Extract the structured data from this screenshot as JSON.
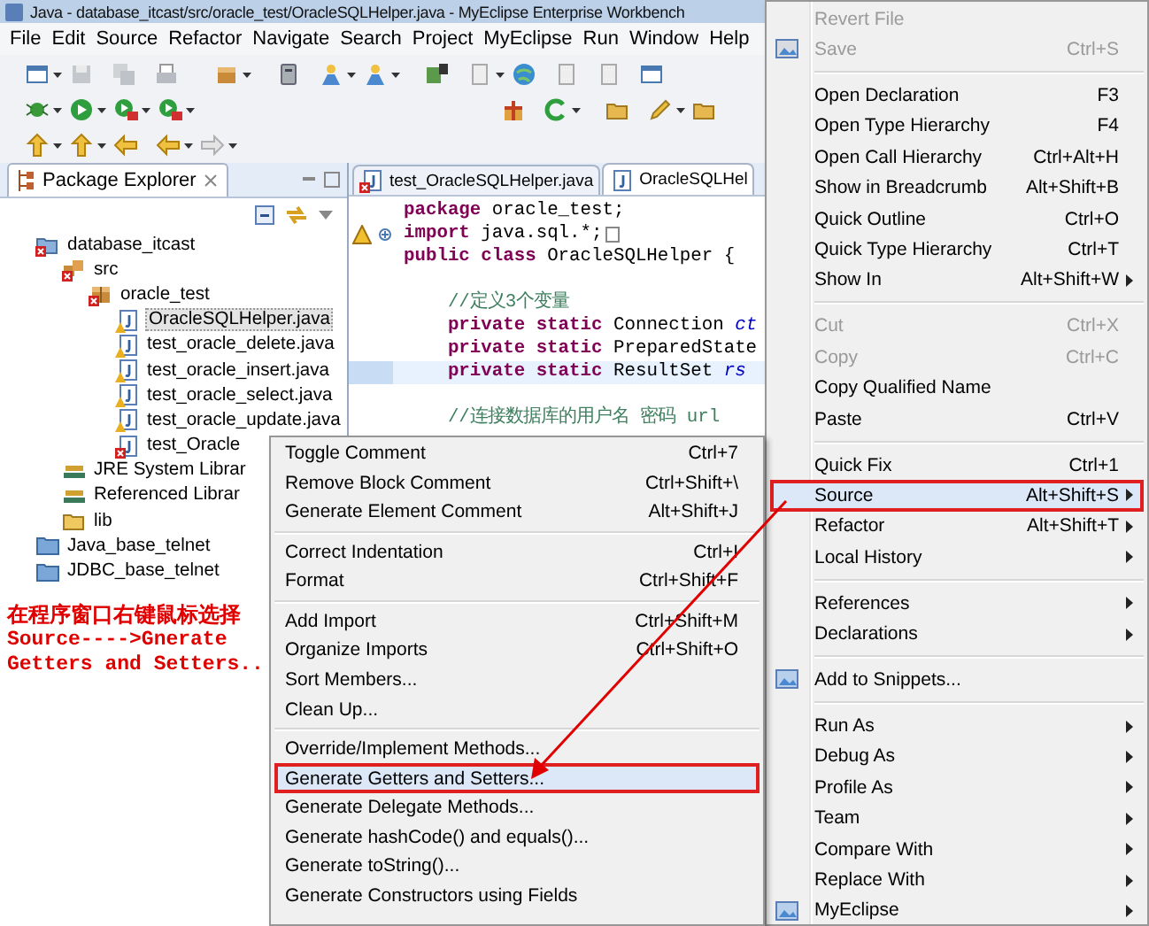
{
  "window": {
    "title": "Java - database_itcast/src/oracle_test/OracleSQLHelper.java - MyEclipse Enterprise Workbench"
  },
  "menu_bar": [
    "File",
    "Edit",
    "Source",
    "Refactor",
    "Navigate",
    "Search",
    "Project",
    "MyEclipse",
    "Run",
    "Window",
    "Help"
  ],
  "package_explorer": {
    "title": "Package Explorer",
    "tree": [
      {
        "label": "database_itcast",
        "kind": "project",
        "error": true,
        "warning": false,
        "selected": false,
        "children": [
          {
            "label": "src",
            "kind": "source-folder",
            "error": true,
            "warning": false,
            "selected": false,
            "children": [
              {
                "label": "oracle_test",
                "kind": "package",
                "error": true,
                "warning": false,
                "selected": false,
                "children": [
                  {
                    "label": "OracleSQLHelper.java",
                    "kind": "java-file",
                    "error": false,
                    "warning": true,
                    "selected": true
                  },
                  {
                    "label": "test_oracle_delete.java",
                    "kind": "java-file",
                    "error": false,
                    "warning": true,
                    "selected": false
                  },
                  {
                    "label": "test_oracle_insert.java",
                    "kind": "java-file",
                    "error": false,
                    "warning": true,
                    "selected": false
                  },
                  {
                    "label": "test_oracle_select.java",
                    "kind": "java-file",
                    "error": false,
                    "warning": true,
                    "selected": false
                  },
                  {
                    "label": "test_oracle_update.java",
                    "kind": "java-file",
                    "error": false,
                    "warning": true,
                    "selected": false
                  },
                  {
                    "label": "test_Oracle",
                    "kind": "java-file",
                    "error": true,
                    "warning": false,
                    "selected": false
                  }
                ]
              }
            ]
          },
          {
            "label": "JRE System Librar",
            "kind": "library",
            "error": false,
            "warning": false,
            "selected": false
          },
          {
            "label": "Referenced Librar",
            "kind": "library",
            "error": false,
            "warning": false,
            "selected": false
          },
          {
            "label": "lib",
            "kind": "folder",
            "error": false,
            "warning": false,
            "selected": false
          }
        ]
      },
      {
        "label": "Java_base_telnet",
        "kind": "closed-project",
        "error": false,
        "warning": false,
        "selected": false
      },
      {
        "label": "JDBC_base_telnet",
        "kind": "closed-project",
        "error": false,
        "warning": false,
        "selected": false
      }
    ]
  },
  "editor": {
    "tabs": [
      {
        "label": "test_OracleSQLHelper.java",
        "selected": false,
        "error": true
      },
      {
        "label": "OracleSQLHel",
        "selected": true,
        "error": false
      }
    ],
    "lines": [
      {
        "current": false,
        "tokens": [
          {
            "kind": "keyword",
            "text": "package"
          },
          {
            "kind": "plain",
            "text": " oracle_test;"
          }
        ]
      },
      {
        "current": false,
        "folded": true,
        "warning": true,
        "tokens": [
          {
            "kind": "keyword",
            "text": "import"
          },
          {
            "kind": "plain",
            "text": " java.sql.*;"
          }
        ]
      },
      {
        "current": false,
        "tokens": [
          {
            "kind": "keyword",
            "text": "public class"
          },
          {
            "kind": "plain",
            "text": " OracleSQLHelper {"
          }
        ]
      },
      {
        "current": false
      },
      {
        "current": false,
        "tokens": [
          {
            "kind": "comment",
            "text": "    //定义3个变量"
          }
        ]
      },
      {
        "current": false,
        "tokens": [
          {
            "kind": "keyword",
            "text": "    private static"
          },
          {
            "kind": "plain",
            "text": " Connection "
          },
          {
            "kind": "field",
            "text": "ct"
          }
        ]
      },
      {
        "current": false,
        "tokens": [
          {
            "kind": "keyword",
            "text": "    private static"
          },
          {
            "kind": "plain",
            "text": " PreparedState"
          }
        ]
      },
      {
        "current": true,
        "tokens": [
          {
            "kind": "keyword",
            "text": "    private static"
          },
          {
            "kind": "plain",
            "text": " ResultSet "
          },
          {
            "kind": "field",
            "text": "rs"
          }
        ]
      },
      {
        "current": false
      },
      {
        "current": false,
        "tokens": [
          {
            "kind": "comment",
            "text": "    //连接数据库的用户名 密码 url"
          }
        ]
      }
    ]
  },
  "source_submenu": {
    "items": [
      {
        "kind": "item",
        "label": "Toggle Comment",
        "shortcut": "Ctrl+7",
        "disabled": false,
        "highlighted": false
      },
      {
        "kind": "item",
        "label": "Remove Block Comment",
        "shortcut": "Ctrl+Shift+\\",
        "disabled": false,
        "highlighted": false
      },
      {
        "kind": "item",
        "label": "Generate Element Comment",
        "shortcut": "Alt+Shift+J",
        "disabled": false,
        "highlighted": false
      },
      {
        "kind": "separator"
      },
      {
        "kind": "item",
        "label": "Correct Indentation",
        "shortcut": "Ctrl+I",
        "disabled": false,
        "highlighted": false
      },
      {
        "kind": "item",
        "label": "Format",
        "shortcut": "Ctrl+Shift+F",
        "disabled": false,
        "highlighted": false
      },
      {
        "kind": "separator"
      },
      {
        "kind": "item",
        "label": "Add Import",
        "shortcut": "Ctrl+Shift+M",
        "disabled": false,
        "highlighted": false
      },
      {
        "kind": "item",
        "label": "Organize Imports",
        "shortcut": "Ctrl+Shift+O",
        "disabled": false,
        "highlighted": false
      },
      {
        "kind": "item",
        "label": "Sort Members...",
        "disabled": false,
        "highlighted": false
      },
      {
        "kind": "item",
        "label": "Clean Up...",
        "disabled": false,
        "highlighted": false
      },
      {
        "kind": "separator"
      },
      {
        "kind": "item",
        "label": "Override/Implement Methods...",
        "disabled": false,
        "highlighted": false
      },
      {
        "kind": "item",
        "label": "Generate Getters and Setters...",
        "disabled": false,
        "highlighted": true
      },
      {
        "kind": "item",
        "label": "Generate Delegate Methods...",
        "disabled": false,
        "highlighted": false
      },
      {
        "kind": "item",
        "label": "Generate hashCode() and equals()...",
        "disabled": false,
        "highlighted": false
      },
      {
        "kind": "item",
        "label": "Generate toString()...",
        "disabled": false,
        "highlighted": false
      },
      {
        "kind": "item",
        "label": "Generate Constructors using Fields",
        "disabled": false,
        "highlighted": false
      }
    ]
  },
  "context_menu": {
    "items": [
      {
        "kind": "item",
        "label": "Revert File",
        "disabled": true,
        "highlighted": false,
        "submenu": false
      },
      {
        "kind": "item",
        "label": "Save",
        "shortcut": "Ctrl+S",
        "disabled": true,
        "highlighted": false,
        "submenu": false,
        "has_icon": true
      },
      {
        "kind": "separator"
      },
      {
        "kind": "item",
        "label": "Open Declaration",
        "shortcut": "F3",
        "disabled": false,
        "highlighted": false,
        "submenu": false
      },
      {
        "kind": "item",
        "label": "Open Type Hierarchy",
        "shortcut": "F4",
        "disabled": false,
        "highlighted": false,
        "submenu": false
      },
      {
        "kind": "item",
        "label": "Open Call Hierarchy",
        "shortcut": "Ctrl+Alt+H",
        "disabled": false,
        "highlighted": false,
        "submenu": false
      },
      {
        "kind": "item",
        "label": "Show in Breadcrumb",
        "shortcut": "Alt+Shift+B",
        "disabled": false,
        "highlighted": false,
        "submenu": false
      },
      {
        "kind": "item",
        "label": "Quick Outline",
        "shortcut": "Ctrl+O",
        "disabled": false,
        "highlighted": false,
        "submenu": false
      },
      {
        "kind": "item",
        "label": "Quick Type Hierarchy",
        "shortcut": "Ctrl+T",
        "disabled": false,
        "highlighted": false,
        "submenu": false
      },
      {
        "kind": "item",
        "label": "Show In",
        "shortcut": "Alt+Shift+W",
        "disabled": false,
        "highlighted": false,
        "submenu": true
      },
      {
        "kind": "separator"
      },
      {
        "kind": "item",
        "label": "Cut",
        "shortcut": "Ctrl+X",
        "disabled": true,
        "highlighted": false,
        "submenu": false
      },
      {
        "kind": "item",
        "label": "Copy",
        "shortcut": "Ctrl+C",
        "disabled": true,
        "highlighted": false,
        "submenu": false
      },
      {
        "kind": "item",
        "label": "Copy Qualified Name",
        "disabled": false,
        "highlighted": false,
        "submenu": false
      },
      {
        "kind": "item",
        "label": "Paste",
        "shortcut": "Ctrl+V",
        "disabled": false,
        "highlighted": false,
        "submenu": false
      },
      {
        "kind": "separator"
      },
      {
        "kind": "item",
        "label": "Quick Fix",
        "shortcut": "Ctrl+1",
        "disabled": false,
        "highlighted": false,
        "submenu": false
      },
      {
        "kind": "item",
        "label": "Source",
        "shortcut": "Alt+Shift+S",
        "disabled": false,
        "highlighted": true,
        "submenu": true
      },
      {
        "kind": "item",
        "label": "Refactor",
        "shortcut": "Alt+Shift+T",
        "disabled": false,
        "highlighted": false,
        "submenu": true
      },
      {
        "kind": "item",
        "label": "Local History",
        "disabled": false,
        "highlighted": false,
        "submenu": true
      },
      {
        "kind": "separator"
      },
      {
        "kind": "item",
        "label": "References",
        "disabled": false,
        "highlighted": false,
        "submenu": true
      },
      {
        "kind": "item",
        "label": "Declarations",
        "disabled": false,
        "highlighted": false,
        "submenu": true
      },
      {
        "kind": "separator"
      },
      {
        "kind": "item",
        "label": "Add to Snippets...",
        "disabled": false,
        "highlighted": false,
        "submenu": false,
        "has_icon": true
      },
      {
        "kind": "separator"
      },
      {
        "kind": "item",
        "label": "Run As",
        "disabled": false,
        "highlighted": false,
        "submenu": true
      },
      {
        "kind": "item",
        "label": "Debug As",
        "disabled": false,
        "highlighted": false,
        "submenu": true
      },
      {
        "kind": "item",
        "label": "Profile As",
        "disabled": false,
        "highlighted": false,
        "submenu": true
      },
      {
        "kind": "item",
        "label": "Team",
        "disabled": false,
        "highlighted": false,
        "submenu": true
      },
      {
        "kind": "item",
        "label": "Compare With",
        "disabled": false,
        "highlighted": false,
        "submenu": true
      },
      {
        "kind": "item",
        "label": "Replace With",
        "disabled": false,
        "highlighted": false,
        "submenu": true
      },
      {
        "kind": "item",
        "label": "MyEclipse",
        "disabled": false,
        "highlighted": false,
        "submenu": true,
        "has_icon": true
      }
    ]
  },
  "annotation": {
    "lines": [
      "在程序窗口右键鼠标选择",
      "Source---->Gnerate",
      "Getters and Setters.."
    ]
  }
}
